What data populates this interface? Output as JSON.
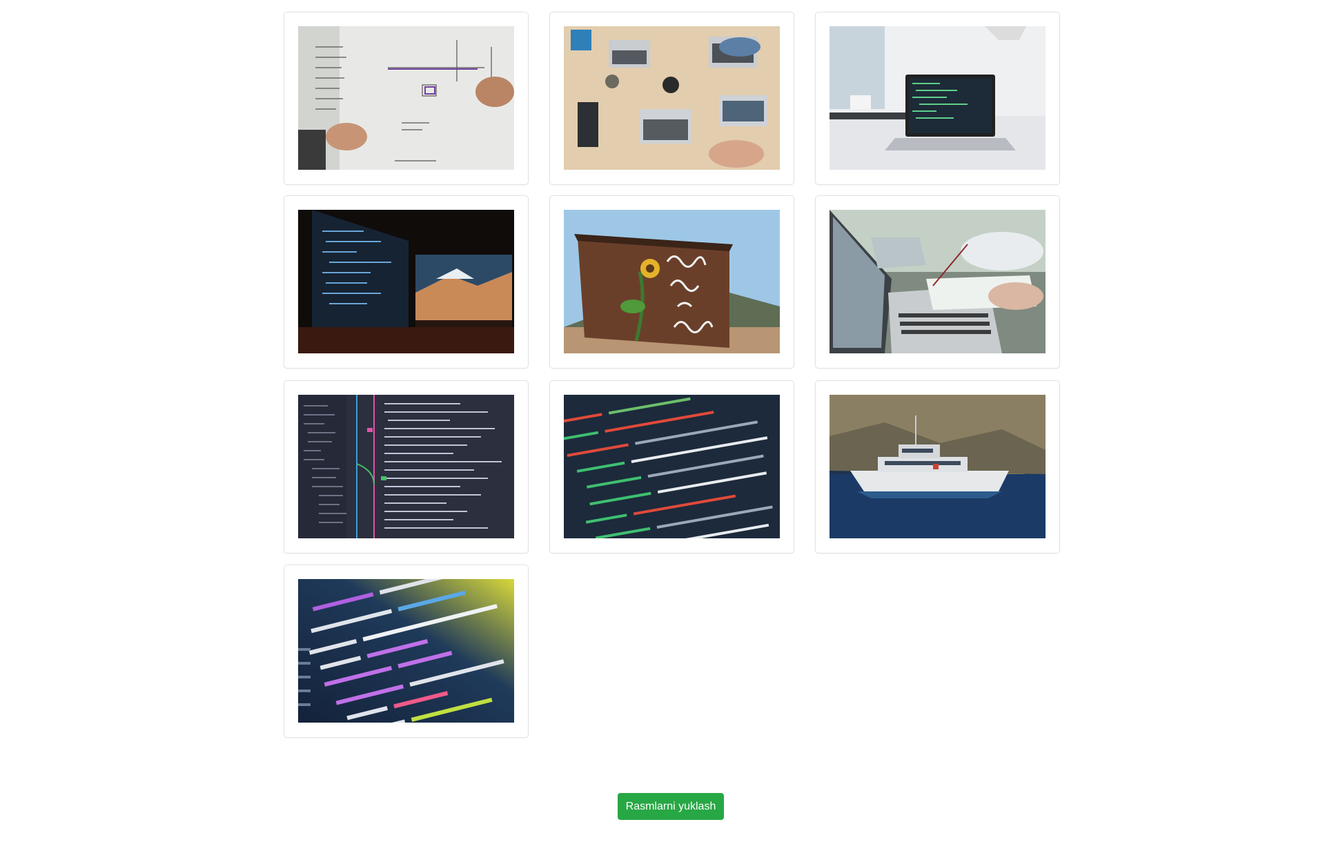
{
  "gallery": {
    "images": [
      {
        "subject": "whiteboard-planning"
      },
      {
        "subject": "team-desk-laptops"
      },
      {
        "subject": "laptop-code-desk"
      },
      {
        "subject": "dual-monitor-code"
      },
      {
        "subject": "always-room-to-grow-mural"
      },
      {
        "subject": "laptop-paperwork"
      },
      {
        "subject": "git-history-editor"
      },
      {
        "subject": "svg-code-closeup"
      },
      {
        "subject": "research-boat"
      },
      {
        "subject": "php-code-closeup"
      }
    ]
  },
  "actions": {
    "upload_label": "Rasmlarni yuklash",
    "upload_color": "#28a745"
  }
}
